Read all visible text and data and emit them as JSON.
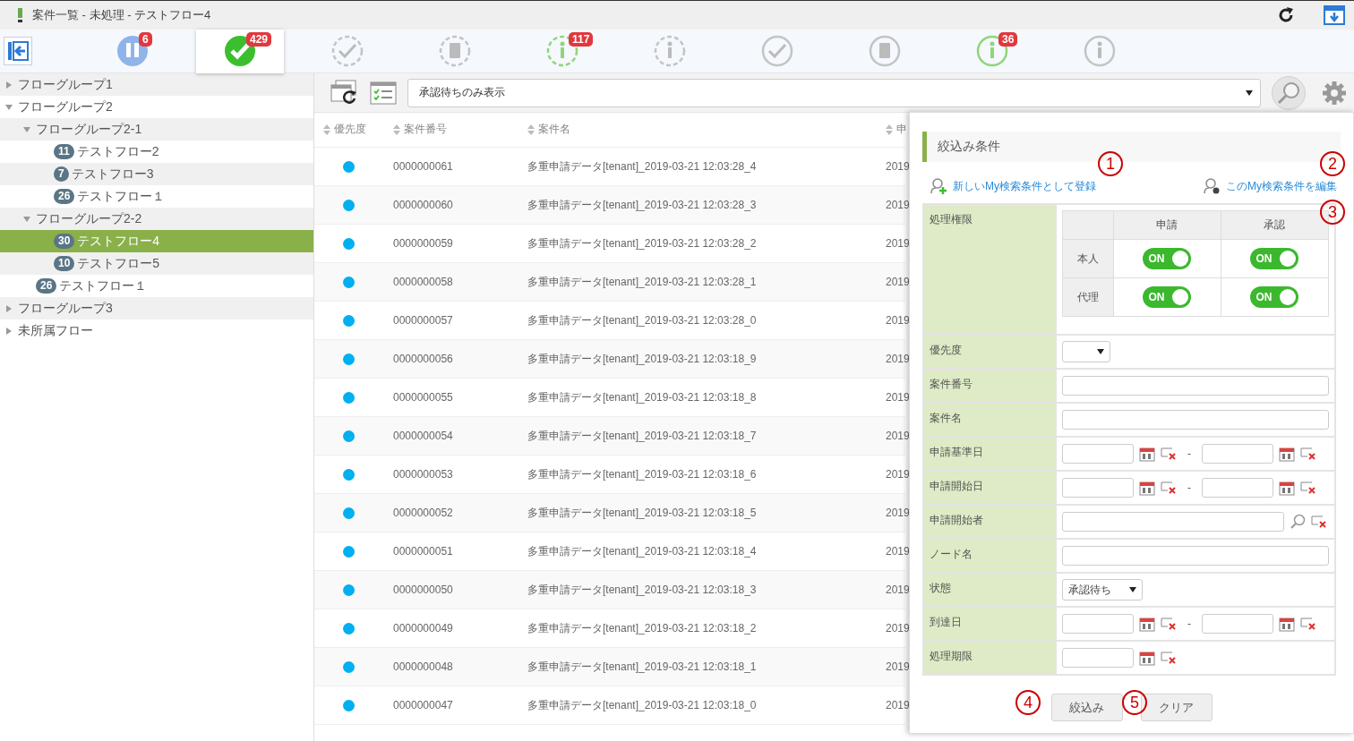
{
  "window": {
    "title": "案件一覧 - 未処理 - テストフロー4"
  },
  "tabs": [
    {
      "kind": "pause",
      "color": "#8fb4ea",
      "badge": "6",
      "selected": false
    },
    {
      "kind": "done",
      "color": "#3bbf2e",
      "badge": "429",
      "selected": true
    },
    {
      "kind": "check",
      "dashed": true,
      "color": "#c4c4c4",
      "selected": false
    },
    {
      "kind": "doc",
      "dashed": true,
      "color": "#c4c4c4",
      "selected": false
    },
    {
      "kind": "info",
      "dashed": true,
      "color": "#8fd67a",
      "badge": "117",
      "selected": false
    },
    {
      "kind": "info",
      "dashed": true,
      "color": "#c4c4c4",
      "selected": false
    },
    {
      "kind": "check",
      "dashed": false,
      "color": "#c4c4c4",
      "selected": false
    },
    {
      "kind": "doc",
      "dashed": false,
      "color": "#c4c4c4",
      "selected": false
    },
    {
      "kind": "info",
      "dashed": false,
      "color": "#8fd67a",
      "badge": "36",
      "selected": false
    },
    {
      "kind": "info",
      "dashed": false,
      "color": "#c4c4c4",
      "selected": false
    }
  ],
  "flow_tree": [
    {
      "label": "フローグループ1",
      "expanded": false
    },
    {
      "label": "フローグループ2",
      "expanded": true,
      "children": [
        {
          "label": "フローグループ2-1",
          "expanded": true,
          "children": [
            {
              "label": "テストフロー2",
              "badge": "11",
              "selected": false
            },
            {
              "label": "テストフロー3",
              "badge": "7",
              "selected": false
            },
            {
              "label": "テストフロー１",
              "badge": "26",
              "selected": false
            }
          ]
        },
        {
          "label": "フローグループ2-2",
          "expanded": true,
          "children": [
            {
              "label": "テストフロー4",
              "badge": "30",
              "selected": true
            },
            {
              "label": "テストフロー5",
              "badge": "10",
              "selected": false
            }
          ]
        },
        {
          "label": "テストフロー１",
          "badge": "26",
          "selected": false
        }
      ]
    },
    {
      "label": "フローグループ3",
      "expanded": false
    },
    {
      "label": "未所属フロー",
      "expanded": false
    }
  ],
  "list_filter": {
    "value": "承認待ちのみ表示"
  },
  "table": {
    "columns": [
      "優先度",
      "案件番号",
      "案件名",
      "申"
    ],
    "rows": [
      [
        "",
        "0000000061",
        "多重申請データ[tenant]_2019-03-21 12:03:28_4",
        "2019"
      ],
      [
        "",
        "0000000060",
        "多重申請データ[tenant]_2019-03-21 12:03:28_3",
        "2019"
      ],
      [
        "",
        "0000000059",
        "多重申請データ[tenant]_2019-03-21 12:03:28_2",
        "2019"
      ],
      [
        "",
        "0000000058",
        "多重申請データ[tenant]_2019-03-21 12:03:28_1",
        "2019"
      ],
      [
        "",
        "0000000057",
        "多重申請データ[tenant]_2019-03-21 12:03:28_0",
        "2019"
      ],
      [
        "",
        "0000000056",
        "多重申請データ[tenant]_2019-03-21 12:03:18_9",
        "2019"
      ],
      [
        "",
        "0000000055",
        "多重申請データ[tenant]_2019-03-21 12:03:18_8",
        "2019"
      ],
      [
        "",
        "0000000054",
        "多重申請データ[tenant]_2019-03-21 12:03:18_7",
        "2019"
      ],
      [
        "",
        "0000000053",
        "多重申請データ[tenant]_2019-03-21 12:03:18_6",
        "2019"
      ],
      [
        "",
        "0000000052",
        "多重申請データ[tenant]_2019-03-21 12:03:18_5",
        "2019"
      ],
      [
        "",
        "0000000051",
        "多重申請データ[tenant]_2019-03-21 12:03:18_4",
        "2019"
      ],
      [
        "",
        "0000000050",
        "多重申請データ[tenant]_2019-03-21 12:03:18_3",
        "2019"
      ],
      [
        "",
        "0000000049",
        "多重申請データ[tenant]_2019-03-21 12:03:18_2",
        "2019"
      ],
      [
        "",
        "0000000048",
        "多重申請データ[tenant]_2019-03-21 12:03:18_1",
        "2019"
      ],
      [
        "",
        "0000000047",
        "多重申請データ[tenant]_2019-03-21 12:03:18_0",
        "2019"
      ]
    ]
  },
  "filter_panel": {
    "title": "絞込み条件",
    "links": [
      {
        "kind": "add",
        "label": "新しいMy検索条件として登録"
      },
      {
        "kind": "edit",
        "label": "このMy検索条件を編集"
      }
    ],
    "fields": [
      {
        "kind": "permission",
        "label": "処理権限",
        "columns": [
          "申請",
          "承認"
        ],
        "rows": [
          {
            "label": "本人",
            "toggles": [
              {
                "label": "ON",
                "on": true
              },
              {
                "label": "ON",
                "on": true
              }
            ]
          },
          {
            "label": "代理",
            "toggles": [
              {
                "label": "ON",
                "on": true
              },
              {
                "label": "ON",
                "on": true
              }
            ]
          }
        ]
      },
      {
        "kind": "select",
        "label": "優先度"
      },
      {
        "kind": "text",
        "label": "案件番号"
      },
      {
        "kind": "text",
        "label": "案件名"
      },
      {
        "kind": "date_range",
        "label": "申請基準日",
        "separator": "-"
      },
      {
        "kind": "date_range",
        "label": "申請開始日",
        "separator": "-"
      },
      {
        "kind": "user",
        "label": "申請開始者"
      },
      {
        "kind": "text",
        "label": "ノード名"
      },
      {
        "kind": "select",
        "label": "状態",
        "value": "承認待ち"
      },
      {
        "kind": "date_range",
        "label": "到達日",
        "separator": "-"
      },
      {
        "kind": "date",
        "label": "処理期限"
      }
    ],
    "buttons": [
      "絞込み",
      "クリア"
    ]
  },
  "callouts": [
    "1",
    "2",
    "3",
    "4",
    "5"
  ]
}
